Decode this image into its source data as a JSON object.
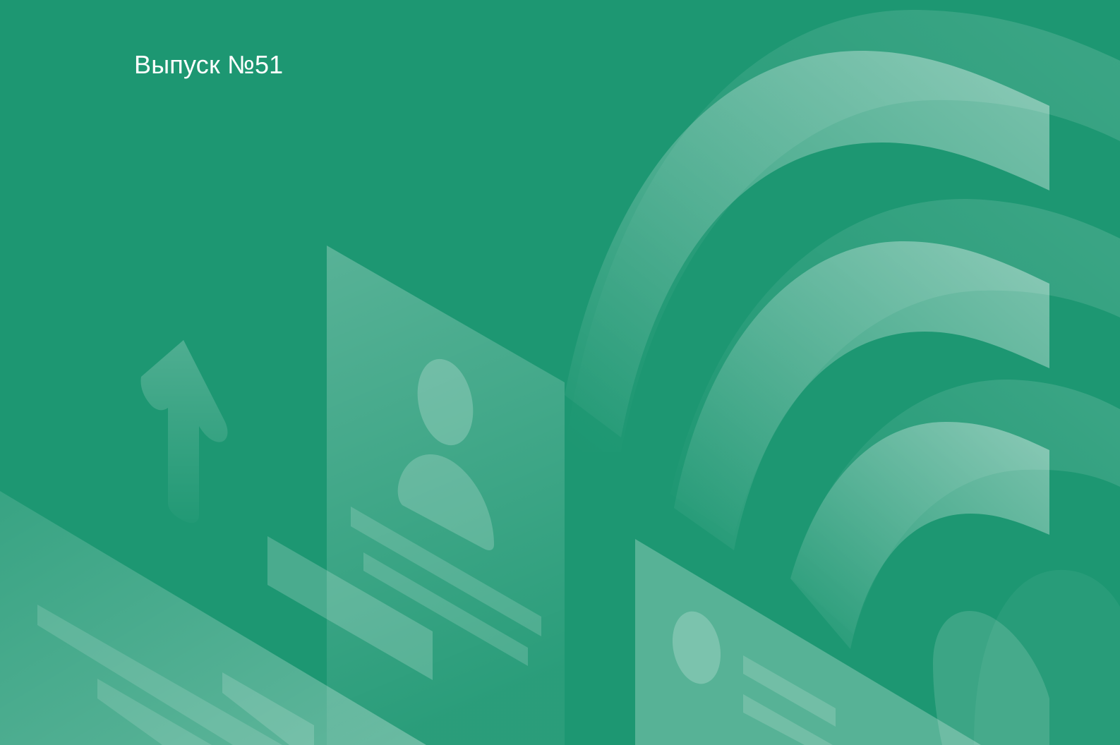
{
  "cover": {
    "issue_label": "Выпуск №51"
  },
  "colors": {
    "background": "#1d9772",
    "text": "#ffffff",
    "illustration_tint": "#a9e6cf"
  },
  "illustration": {
    "icons": [
      "up-arrow-icon",
      "profile-card-icon",
      "user-avatar-icon",
      "wifi-signal-arcs-icon"
    ]
  }
}
